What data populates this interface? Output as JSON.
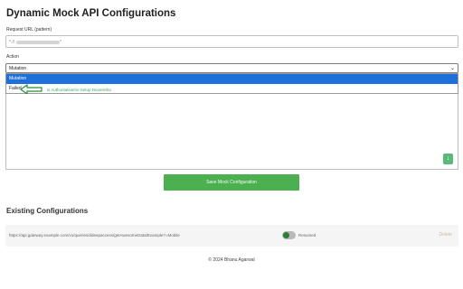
{
  "page": {
    "title": "Dynamic Mock API Configurations"
  },
  "form": {
    "url_label": "Request URL (pattern)",
    "url_prefix": "*://",
    "url_suffix": "*",
    "action_label": "Action",
    "action_selected": "Mutation",
    "action_options": [
      "Mutation",
      "Failed"
    ],
    "annotation": "is Authoritative/no Setup Nooeretha",
    "save_label": "Save Mock Configuration"
  },
  "existing": {
    "title": "Existing Configurations",
    "rows": [
      {
        "url": "https://api.gateway.example.com/v1/queries/ddeepaccess/getAwesomeData/Example?=Mobile",
        "status": "Resumed",
        "delete_label": "Delete"
      }
    ]
  },
  "footer": {
    "text": "© 2024 Bhanu Agarwal"
  },
  "colors": {
    "primary_green": "#4caf50",
    "select_blue": "#1e6fd9",
    "annotation_green": "#3ea75a"
  },
  "icons": {
    "dropdown": "chevron-down-icon",
    "resize": "resize-down-icon",
    "pointer": "arrow-left-icon"
  }
}
